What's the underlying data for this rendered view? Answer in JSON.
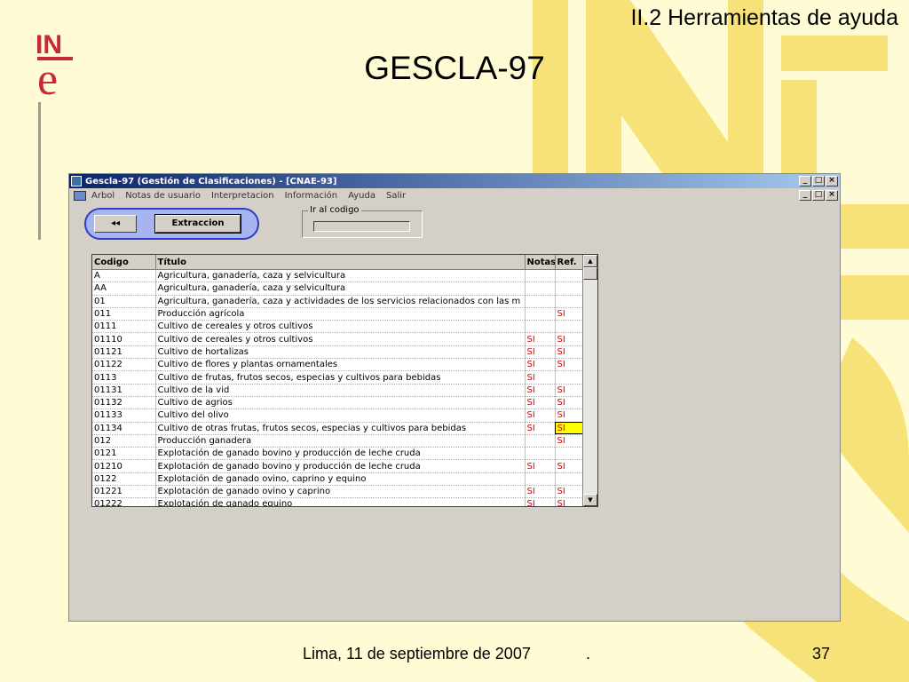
{
  "slide": {
    "section": "II.2 Herramientas de ayuda",
    "title": "GESCLA-97",
    "footer_date": "Lima, 11 de septiembre de 2007",
    "footer_dot": ".",
    "page_number": "37"
  },
  "logo": {
    "text": "INE"
  },
  "window": {
    "title": "Gescla-97 (Gestión de Clasificaciones) - [CNAE-93]",
    "menu": [
      "Arbol",
      "Notas de usuario",
      "Interpretacion",
      "Información",
      "Ayuda",
      "Salir"
    ],
    "back_button": "◂◂",
    "extract_button": "Extraccion",
    "goto_label": "Ir al codigo",
    "goto_value": ""
  },
  "grid": {
    "columns": [
      "Codigo",
      "Título",
      "Notas",
      "Ref."
    ],
    "rows": [
      [
        "A",
        "Agricultura,  ganadería, caza y selvicultura",
        "",
        ""
      ],
      [
        "AA",
        "Agricultura, ganadería, caza y selvicultura",
        "",
        ""
      ],
      [
        "01",
        "Agricultura, ganadería, caza y actividades de los servicios relacionados con las m",
        "",
        ""
      ],
      [
        "011",
        "Producción agrícola",
        "",
        "SI"
      ],
      [
        "0111",
        "Cultivo de cereales y otros cultivos",
        "",
        ""
      ],
      [
        "01110",
        "Cultivo de cereales y otros cultivos",
        "SI",
        "SI"
      ],
      [
        "01121",
        "Cultivo de hortalizas",
        "SI",
        "SI"
      ],
      [
        "01122",
        "Cultivo de flores y plantas ornamentales",
        "SI",
        "SI"
      ],
      [
        "0113",
        "Cultivo de frutas, frutos secos, especias y cultivos para bebidas",
        "SI",
        ""
      ],
      [
        "01131",
        "Cultivo de la vid",
        "SI",
        "SI"
      ],
      [
        "01132",
        "Cultivo de agrios",
        "SI",
        "SI"
      ],
      [
        "01133",
        "Cultivo del olivo",
        "SI",
        "SI"
      ],
      [
        "01134",
        "Cultivo de otras frutas, frutos secos, especias y cultivos para bebidas",
        "SI",
        "SI"
      ],
      [
        "012",
        "Producción ganadera",
        "",
        "SI"
      ],
      [
        "0121",
        "Explotación de ganado bovino y producción de leche cruda",
        "",
        ""
      ],
      [
        "01210",
        "Explotación de ganado bovino y producción de leche cruda",
        "SI",
        "SI"
      ],
      [
        "0122",
        "Explotación de ganado ovino, caprino y equino",
        "",
        ""
      ],
      [
        "01221",
        "Explotación de ganado ovino y caprino",
        "SI",
        "SI"
      ],
      [
        "01222",
        "Explotación de ganado equino",
        "SI",
        "SI"
      ]
    ],
    "selected_row": 12,
    "selected_col": 3
  },
  "colors": {
    "slide_background": "#fffcd5",
    "watermark": "#f7e27a",
    "window_face": "#d4d0c8",
    "titlebar": "#0a246a",
    "flag_text": "#e00000",
    "selection": "#ffff00",
    "button_group_border": "#2e3cc8"
  }
}
